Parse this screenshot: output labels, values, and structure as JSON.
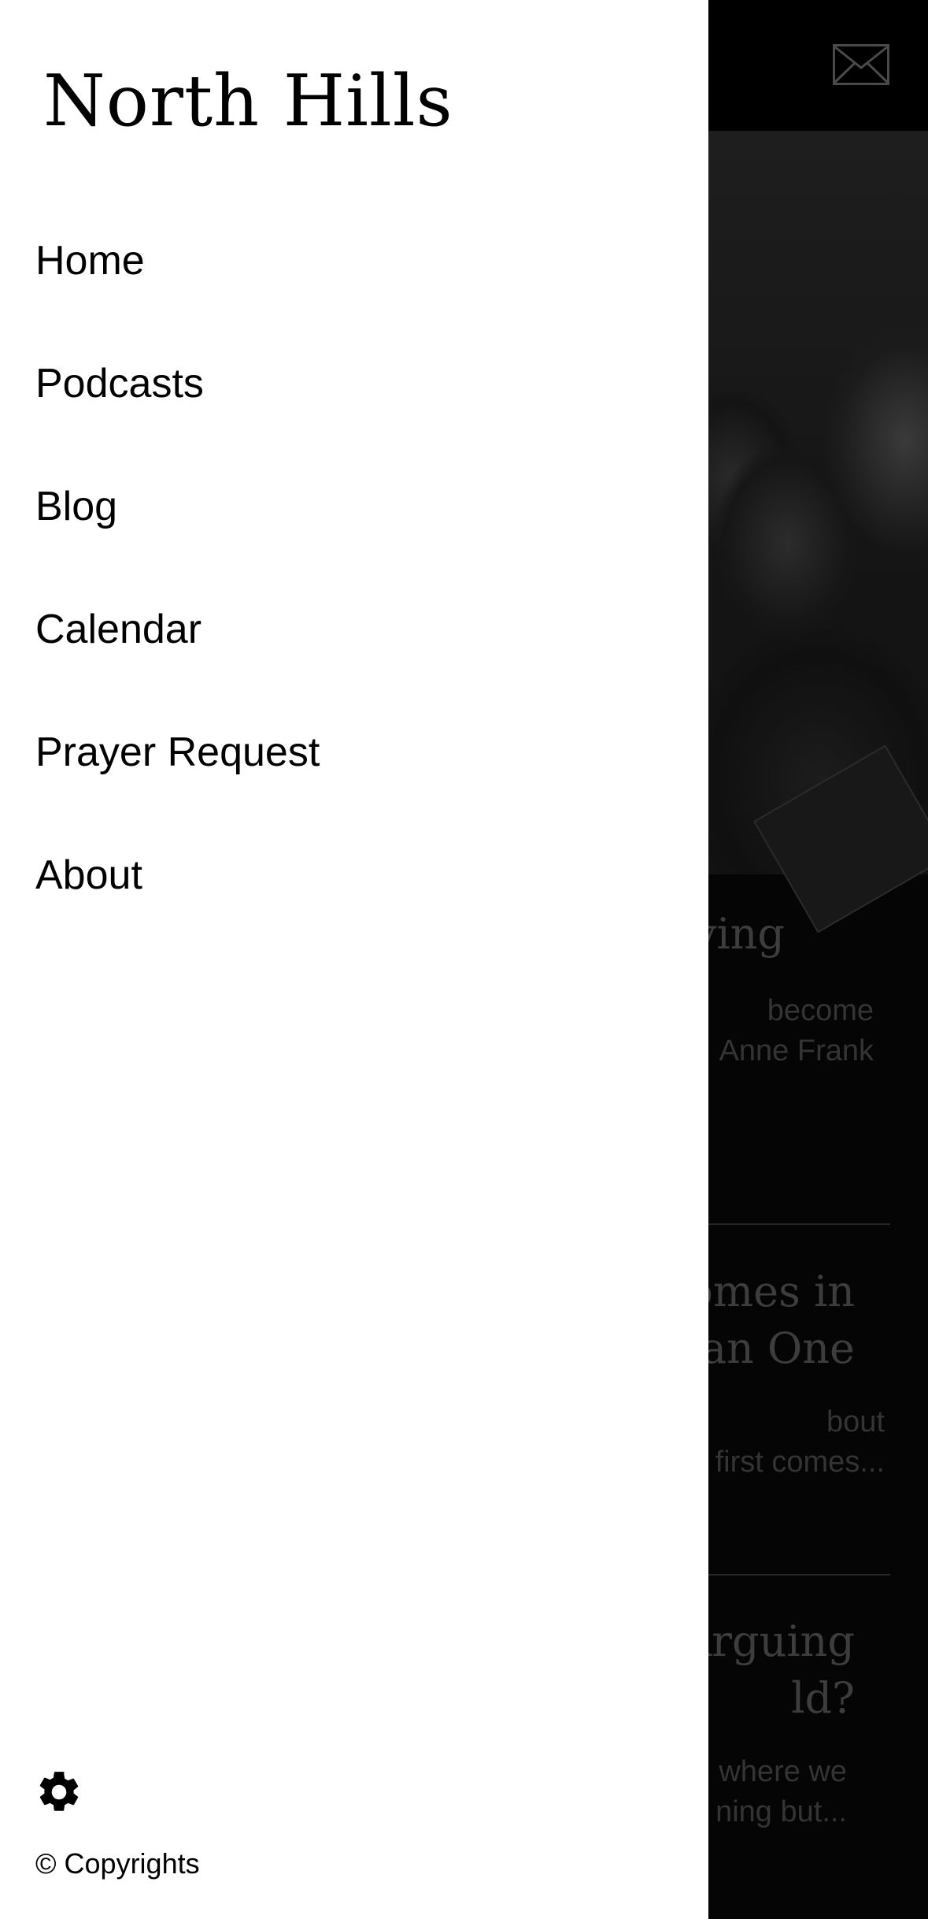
{
  "drawer": {
    "title": "North Hills",
    "nav_items": [
      {
        "label": "Home"
      },
      {
        "label": "Podcasts"
      },
      {
        "label": "Blog"
      },
      {
        "label": "Calendar"
      },
      {
        "label": "Prayer Request"
      },
      {
        "label": "About"
      }
    ],
    "footer": {
      "settings_icon": "gear-icon",
      "copyright": "© Copyrights"
    }
  },
  "background": {
    "header": {
      "mail_icon": "mail-icon"
    },
    "hero_image": "people-reading-photo",
    "cards": [
      {
        "title_visible": "ving",
        "text_visible": "become\nAnne Frank"
      },
      {
        "title_visible": "omes in\nthan One",
        "text_visible": "bout\nfirst comes..."
      },
      {
        "title_visible": "Arguing\nld?",
        "text_visible": "where we\nning but..."
      }
    ]
  },
  "colors": {
    "drawer_background": "#ffffff",
    "overlay": "#000000",
    "text": "#000000"
  }
}
